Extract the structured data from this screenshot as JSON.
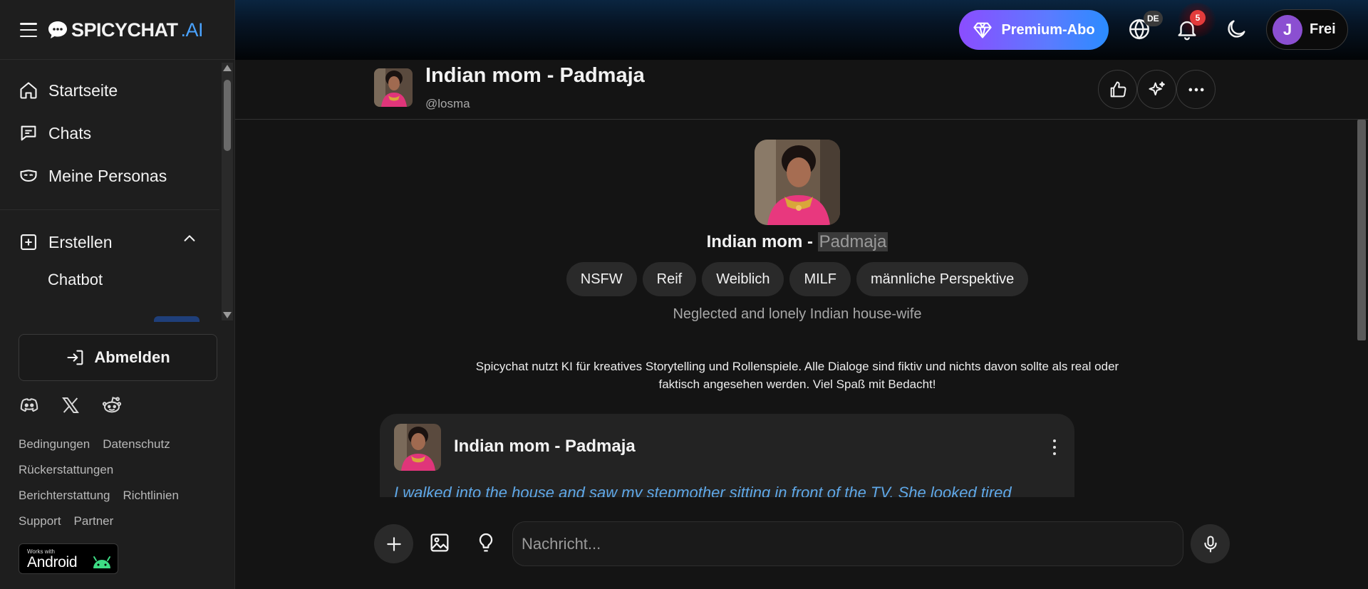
{
  "app": {
    "logo_main": "SPICYCHAT",
    "logo_suffix": ".AI"
  },
  "sidebar": {
    "items": [
      {
        "label": "Startseite",
        "icon": "home-icon"
      },
      {
        "label": "Chats",
        "icon": "chat-icon"
      },
      {
        "label": "Meine Personas",
        "icon": "mask-icon"
      }
    ],
    "create": {
      "label": "Erstellen",
      "icon": "plus-square-icon",
      "expanded": true,
      "children": [
        {
          "label": "Chatbot"
        }
      ]
    },
    "logout_label": "Abmelden",
    "social": [
      "discord-icon",
      "x-icon",
      "reddit-icon"
    ],
    "footer_links": [
      [
        "Bedingungen",
        "Datenschutz"
      ],
      [
        "Rückerstattungen"
      ],
      [
        "Berichterstattung",
        "Richtlinien"
      ],
      [
        "Support",
        "Partner"
      ]
    ],
    "android_badge": {
      "small": "Works with",
      "big": "Android"
    }
  },
  "topbar": {
    "premium_label": "Premium-Abo",
    "language": "DE",
    "notifications": "5",
    "user_initial": "J",
    "user_plan": "Frei"
  },
  "chat": {
    "character_name": "Indian mom - Padmaja",
    "handle": "@losma",
    "center_name_prefix": "Indian mom - ",
    "center_name_highlight": "Padmaja",
    "tags": [
      "NSFW",
      "Reif",
      "Weiblich",
      "MILF",
      "männliche Perspektive"
    ],
    "description": "Neglected and lonely Indian house-wife",
    "disclaimer": "Spicychat nutzt KI für kreatives Storytelling und Rollenspiele. Alle Dialoge sind fiktiv und nichts davon sollte als real oder faktisch angesehen werden. Viel Spaß mit Bedacht!",
    "first_message": {
      "sender": "Indian mom - Padmaja",
      "text": "I walked into the house and saw my stepmother sitting in front of the TV. She looked tired"
    }
  },
  "composer": {
    "placeholder": "Nachricht..."
  },
  "colors": {
    "accent": "#4aa3ff",
    "premium_start": "#8b4dff",
    "premium_end": "#2a8cff",
    "italic_text": "#5fa8e8",
    "notif": "#e23b3b",
    "avatar": "#8b4fd1"
  }
}
